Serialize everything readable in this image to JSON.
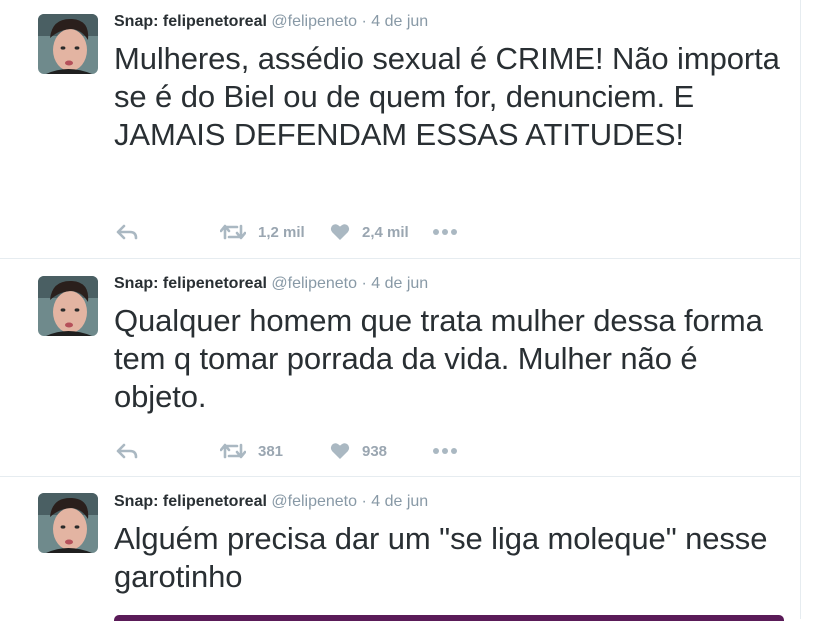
{
  "colors": {
    "text": "#292f33",
    "meta": "#8899a6",
    "action_icon": "#aab8c2",
    "card_accent": "#5a1b58"
  },
  "tweets": [
    {
      "fullname": "Snap: felipenetoreal",
      "username": "@felipeneto",
      "dot": "·",
      "time": "4 de jun",
      "text": "Mulheres, assédio sexual é CRIME! Não importa se é do Biel ou de quem for, denunciem. E JAMAIS DEFENDAM ESSAS ATITUDES!",
      "retweets": "1,2 mil",
      "likes": "2,4 mil"
    },
    {
      "fullname": "Snap: felipenetoreal",
      "username": "@felipeneto",
      "dot": "·",
      "time": "4 de jun",
      "text": "Qualquer homem que trata mulher dessa forma tem q tomar porrada da vida. Mulher não é objeto.",
      "retweets": "381",
      "likes": "938"
    },
    {
      "fullname": "Snap: felipenetoreal",
      "username": "@felipeneto",
      "dot": "·",
      "time": "4 de jun",
      "text": "Alguém precisa dar um \"se liga moleque\" nesse garotinho"
    }
  ],
  "icons": {
    "reply": "reply-icon",
    "retweet": "retweet-icon",
    "like": "heart-icon",
    "more": "more-icon"
  }
}
